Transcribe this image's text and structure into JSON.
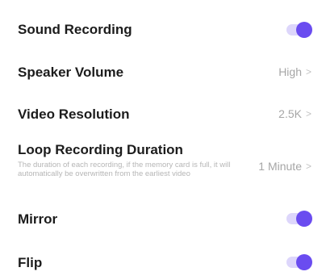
{
  "settings": {
    "sound_recording": {
      "label": "Sound Recording",
      "enabled": true
    },
    "speaker_volume": {
      "label": "Speaker Volume",
      "value": "High"
    },
    "video_resolution": {
      "label": "Video Resolution",
      "value": "2.5K"
    },
    "loop_recording": {
      "label": "Loop Recording Duration",
      "description": "The duration of each recording, if the memory card is full, it will automatically be overwritten from the earliest video",
      "value": "1 Minute"
    },
    "mirror": {
      "label": "Mirror",
      "enabled": true
    },
    "flip": {
      "label": "Flip",
      "enabled": true
    }
  },
  "icons": {
    "chevron": "chevron-right-icon"
  },
  "colors": {
    "toggle_on": "#6a4cf0",
    "toggle_track": "#ddd6fb",
    "text_primary": "#1c1c1c",
    "text_secondary": "#a6a6a6"
  }
}
